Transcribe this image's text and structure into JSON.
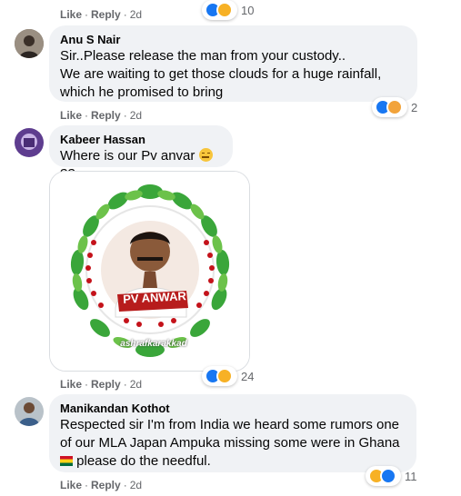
{
  "top_actions": {
    "like": "Like",
    "reply": "Reply",
    "time": "2d",
    "reaction_count": "10"
  },
  "comments": [
    {
      "author": "Anu S Nair",
      "lines": [
        "Sir..Please release the man from your custody..",
        "We are waiting to get those clouds for a huge rainfall,",
        "which he promised to bring"
      ],
      "like": "Like",
      "reply": "Reply",
      "time": "2d",
      "reaction_count": "2"
    },
    {
      "author": "Kabeer Hassan",
      "text_before_emoji": "Where is our Pv anvar ",
      "text_after_emoji": "??",
      "image": {
        "caption": "PV ANWAR",
        "watermark": "ashrafkarakkad"
      },
      "like": "Like",
      "reply": "Reply",
      "time": "2d",
      "reaction_count": "24"
    },
    {
      "author": "Manikandan Kothot",
      "lines": [
        "Respected sir I'm from India we heard some rumors one",
        "of our MLA Japan Ampuka missing some were in Ghana"
      ],
      "last_line_after_flag": " please do the needful.",
      "like": "Like",
      "reply": "Reply",
      "time": "2d",
      "reaction_count": "11"
    }
  ],
  "colors": {
    "bubble": "#f0f2f5",
    "meta": "#65676b",
    "like_blue": "#1877f2",
    "haha_yellow": "#f7b125"
  },
  "icons": [
    "like-reaction-icon",
    "haha-reaction-icon",
    "care-reaction-icon",
    "pensive-emoji-icon",
    "ghana-flag-icon"
  ]
}
